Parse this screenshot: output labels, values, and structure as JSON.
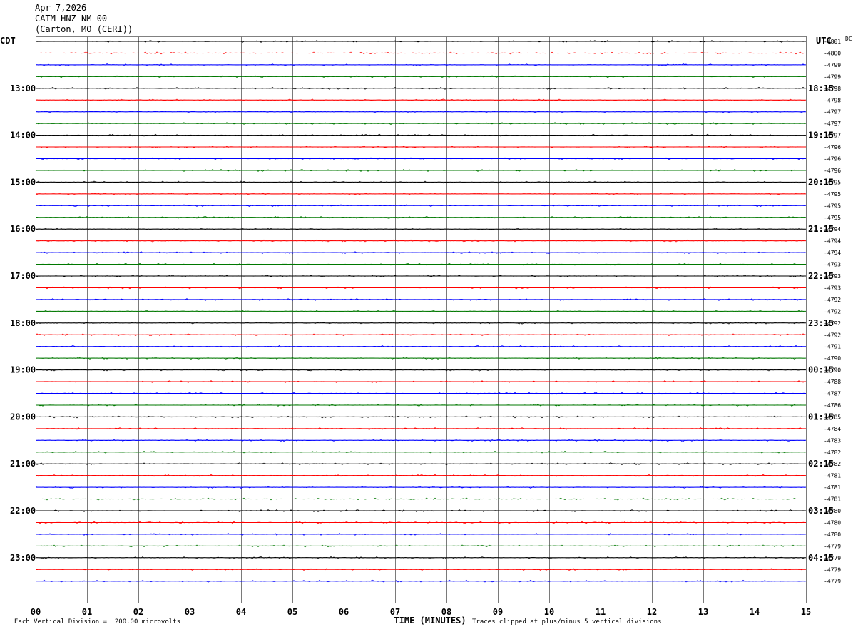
{
  "header": {
    "date": "Apr 7,2026",
    "channel": "CATM HNZ NM 00",
    "location": "(Carton, MO (CERI))"
  },
  "left_tz": "CDT",
  "right_tz": "UTC",
  "dc_label": "DC",
  "footer": {
    "scale_note": "Each Vertical Division =  200.00 microvolts",
    "xlabel": "TIME (MINUTES)",
    "clip_note": "Traces clipped at plus/minus 5 vertical divisions"
  },
  "chart_data": {
    "type": "line",
    "title": "CATM HNZ NM 00",
    "xlabel": "TIME (MINUTES)",
    "x_ticks": [
      "00",
      "01",
      "02",
      "03",
      "04",
      "05",
      "06",
      "07",
      "08",
      "09",
      "10",
      "11",
      "12",
      "13",
      "14",
      "15"
    ],
    "xlim": [
      0,
      15
    ],
    "left_time_labels": [
      "13:00",
      "14:00",
      "15:00",
      "16:00",
      "17:00",
      "18:00",
      "19:00",
      "20:00",
      "21:00",
      "22:00",
      "23:00"
    ],
    "right_time_labels": [
      "18:15",
      "19:15",
      "20:15",
      "21:15",
      "22:15",
      "23:15",
      "00:15",
      "01:15",
      "02:15",
      "03:15",
      "04:15"
    ],
    "trace_colors": [
      "#000000",
      "#ff0000",
      "#0000ff",
      "#007800"
    ],
    "trace_dc_offsets": [
      -4801,
      -4800,
      -4799,
      -4799,
      -4798,
      -4798,
      -4797,
      -4797,
      -4797,
      -4796,
      -4796,
      -4796,
      -4795,
      -4795,
      -4795,
      -4795,
      -4794,
      -4794,
      -4794,
      -4793,
      -4793,
      -4793,
      -4792,
      -4792,
      -4792,
      -4792,
      -4791,
      -4790,
      -4790,
      -4788,
      -4787,
      -4786,
      -4785,
      -4784,
      -4783,
      -4782,
      -4782,
      -4781,
      -4781,
      -4781,
      -4780,
      -4780,
      -4780,
      -4779,
      -4779,
      -4779,
      -4779
    ],
    "grid": true
  }
}
